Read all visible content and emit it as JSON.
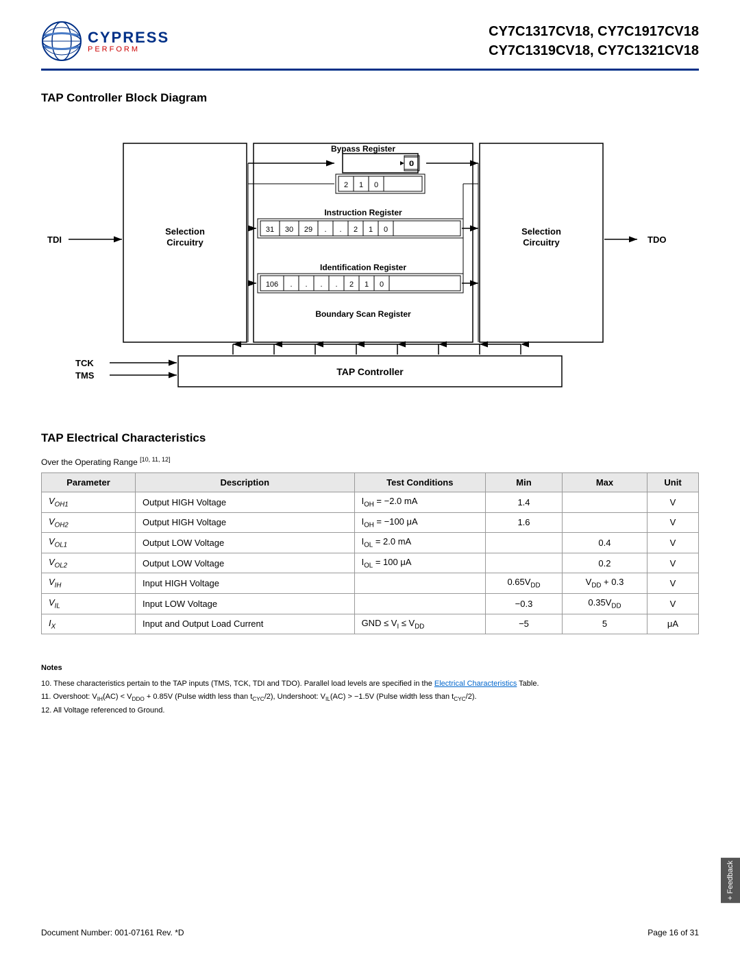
{
  "header": {
    "logo_cypress": "CYPRESS",
    "logo_perform": "PERFORM",
    "title_line1": "CY7C1317CV18, CY7C1917CV18",
    "title_line2": "CY7C1319CV18, CY7C1321CV18"
  },
  "block_diagram": {
    "title": "TAP Controller Block Diagram",
    "labels": {
      "tdi": "TDI",
      "tdo": "TDO",
      "tck": "TCK",
      "tms": "TMS",
      "selection_circuitry_left": "Selection Circuitry",
      "selection_circuitry_right": "Selection Circuitry",
      "bypass_register": "Bypass Register",
      "instruction_register": "Instruction Register",
      "identification_register": "Identification Register",
      "boundary_scan_register": "Boundary Scan Register",
      "tap_controller": "TAP Controller"
    }
  },
  "electrical": {
    "title": "TAP Electrical Characteristics",
    "subtitle": "Over the Operating Range",
    "subtitle_refs": "[10, 11, 12]",
    "table": {
      "headers": [
        "Parameter",
        "Description",
        "Test Conditions",
        "Min",
        "Max",
        "Unit"
      ],
      "rows": [
        {
          "param": "V<sub>OH1</sub>",
          "description": "Output HIGH Voltage",
          "test_conditions": "I<sub>OH</sub> = −2.0 mA",
          "min": "1.4",
          "max": "",
          "unit": "V"
        },
        {
          "param": "V<sub>OH2</sub>",
          "description": "Output HIGH Voltage",
          "test_conditions": "I<sub>OH</sub> = −100 μA",
          "min": "1.6",
          "max": "",
          "unit": "V"
        },
        {
          "param": "V<sub>OL1</sub>",
          "description": "Output LOW Voltage",
          "test_conditions": "I<sub>OL</sub> = 2.0 mA",
          "min": "",
          "max": "0.4",
          "unit": "V"
        },
        {
          "param": "V<sub>OL2</sub>",
          "description": "Output LOW Voltage",
          "test_conditions": "I<sub>OL</sub> = 100 μA",
          "min": "",
          "max": "0.2",
          "unit": "V"
        },
        {
          "param": "V<sub>IH</sub>",
          "description": "Input HIGH Voltage",
          "test_conditions": "",
          "min": "0.65V<sub>DD</sub>",
          "max": "V<sub>DD</sub> + 0.3",
          "unit": "V"
        },
        {
          "param": "V<sub>IL</sub>",
          "description": "Input LOW Voltage",
          "test_conditions": "",
          "min": "−0.3",
          "max": "0.35V<sub>DD</sub>",
          "unit": "V"
        },
        {
          "param": "I<sub>X</sub>",
          "description": "Input and Output Load Current",
          "test_conditions": "GND ≤ V<sub>I</sub> ≤ V<sub>DD</sub>",
          "min": "−5",
          "max": "5",
          "unit": "μA"
        }
      ]
    }
  },
  "notes": {
    "title": "Notes",
    "items": [
      "10. These characteristics pertain to the TAP inputs (TMS, TCK, TDI and TDO). Parallel load levels are specified in the Electrical Characteristics Table.",
      "11. Overshoot: V<sub>IH</sub>(AC) < V<sub>DDO</sub> + 0.85V (Pulse width less than t<sub>CYC</sub>/2), Undershoot: V<sub>IL</sub>(AC) > −1.5V (Pulse width less than t<sub>CYC</sub>/2).",
      "12. All Voltage referenced to Ground."
    ]
  },
  "footer": {
    "doc_number": "Document Number: 001-07161 Rev. *D",
    "page": "Page 16 of 31"
  },
  "feedback": "+ Feedback"
}
